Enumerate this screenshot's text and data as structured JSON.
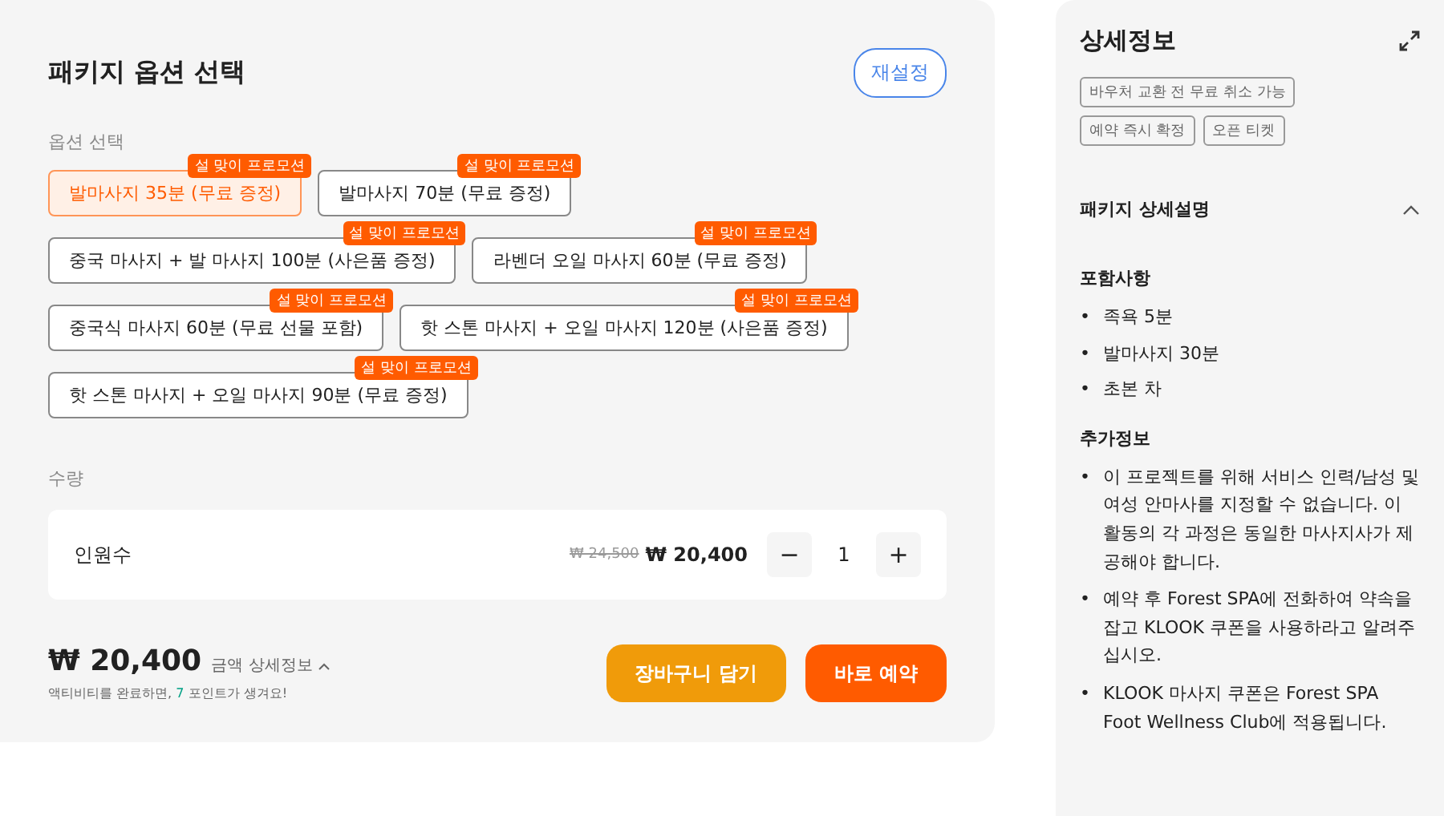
{
  "package": {
    "title": "패키지 옵션 선택",
    "reset_button": "재설정",
    "options_label": "옵션 선택",
    "options": [
      {
        "label": "발마사지 35분 (무료 증정)",
        "badge": "설 맞이 프로모션",
        "selected": true
      },
      {
        "label": "발마사지 70분 (무료 증정)",
        "badge": "설 맞이 프로모션",
        "selected": false
      },
      {
        "label": "중국 마사지 + 발 마사지 100분 (사은품 증정)",
        "badge": "설 맞이 프로모션",
        "selected": false
      },
      {
        "label": "라벤더 오일 마사지 60분 (무료 증정)",
        "badge": "설 맞이 프로모션",
        "selected": false
      },
      {
        "label": "중국식 마사지 60분 (무료 선물 포함)",
        "badge": "설 맞이 프로모션",
        "selected": false
      },
      {
        "label": "핫 스톤 마사지 + 오일 마사지 120분 (사은품 증정)",
        "badge": "설 맞이 프로모션",
        "selected": false
      },
      {
        "label": "핫 스톤 마사지 + 오일 마사지 90분 (무료 증정)",
        "badge": "설 맞이 프로모션",
        "selected": false
      }
    ],
    "quantity_label": "수량",
    "quantity_row": {
      "label": "인원수",
      "original_price": "₩ 24,500",
      "price": "₩ 20,400",
      "minus": "−",
      "count": "1",
      "plus": "+"
    },
    "total": "₩ 20,400",
    "price_details_link": "금액 상세정보",
    "points_note": {
      "before": "액티비티를 완료하면, ",
      "points": "7",
      "after": " 포인트가 생겨요!"
    },
    "cart_button": "장바구니 담기",
    "book_button": "바로 예약"
  },
  "details": {
    "title": "상세정보",
    "tags": [
      "바우처 교환 전 무료 취소 가능",
      "예약 즉시 확정",
      "오픈 티켓"
    ],
    "section_title": "패키지 상세설명",
    "expanded": true,
    "bullet": "•",
    "included_title": "포함사항",
    "included": [
      "족욕 5분",
      "발마사지 30분",
      "초본 차"
    ],
    "extra_title": "추가정보",
    "extra": [
      "이 프로젝트를 위해 서비스 인력/남성 및 여성 안마사를 지정할 수 없습니다. 이 활동의 각 과정은 동일한 마사지사가 제공해야 합니다.",
      "예약 후 Forest SPA에 전화하여 약속을 잡고 KLOOK 쿠폰을 사용하라고 알려주십시오.",
      "KLOOK 마사지 쿠폰은 Forest SPA Foot Wellness Club에 적용됩니다."
    ]
  }
}
